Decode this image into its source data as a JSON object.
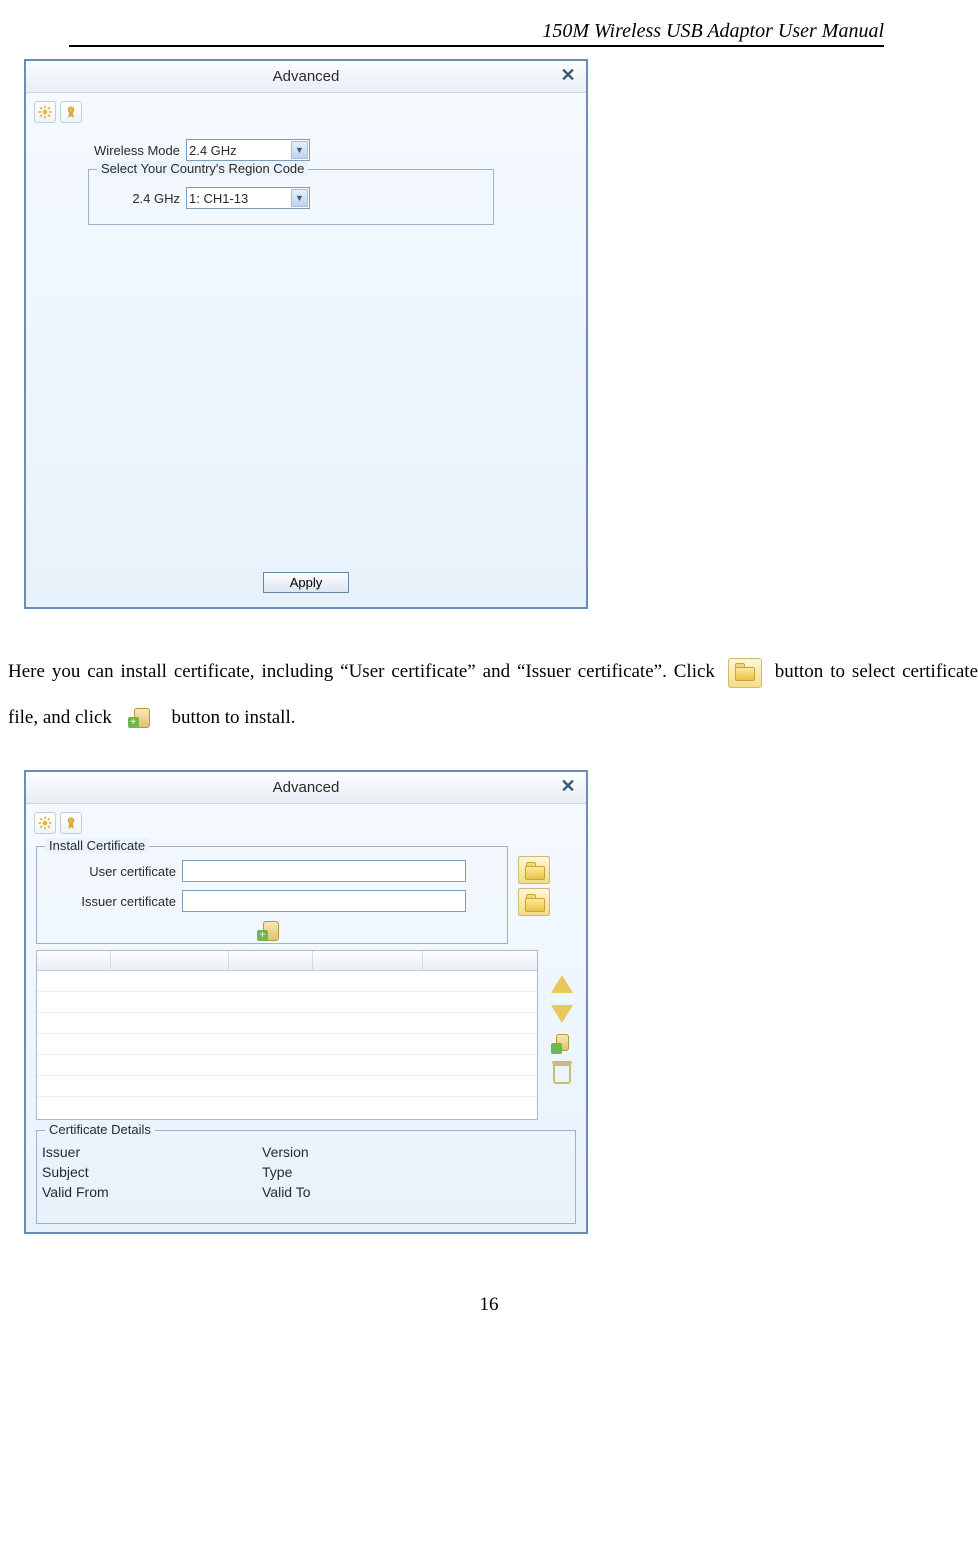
{
  "header": {
    "title": "150M Wireless USB Adaptor User Manual"
  },
  "window1": {
    "title": "Advanced",
    "wireless_mode_label": "Wireless Mode",
    "wireless_mode_value": "2.4 GHz",
    "region_group_label": "Select Your Country's Region Code",
    "region_band_label": "2.4 GHz",
    "region_value": "1: CH1-13",
    "apply_label": "Apply"
  },
  "paragraph": {
    "line1a": "Here you can install certificate, including “User certificate” and “Issuer certificate”. Click",
    "line1b": "button to",
    "line2a": "select certificate file, and click",
    "line2b": "button to install."
  },
  "window2": {
    "title": "Advanced",
    "install_group": "Install Certificate",
    "user_cert_label": "User certificate",
    "issuer_cert_label": "Issuer certificate",
    "details_group": "Certificate Details",
    "details": {
      "issuer": "Issuer",
      "version": "Version",
      "subject": "Subject",
      "type": "Type",
      "valid_from": "Valid From",
      "valid_to": "Valid To"
    }
  },
  "page_number": "16"
}
